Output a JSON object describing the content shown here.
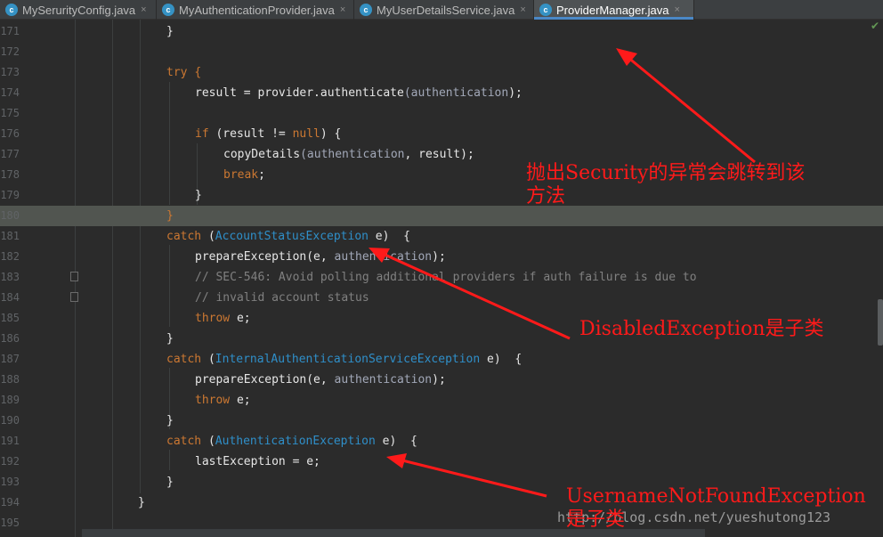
{
  "tabs": [
    {
      "label": "MySerurityConfig.java",
      "icon": "class-icon",
      "active": false
    },
    {
      "label": "MyAuthenticationProvider.java",
      "icon": "class-icon",
      "active": false
    },
    {
      "label": "MyUserDetailsService.java",
      "icon": "class-icon",
      "active": false
    },
    {
      "label": "ProviderManager.java",
      "icon": "class-icon",
      "active": true
    }
  ],
  "tab_close_glyph": "×",
  "tab_icon_letter": "c",
  "inspection_ok_glyph": "✔",
  "lines": [
    {
      "n": "171",
      "tokens": [
        [
          "",
          "}"
        ]
      ]
    },
    {
      "n": "172",
      "tokens": []
    },
    {
      "n": "173",
      "tokens": [
        [
          "kw",
          "try "
        ],
        [
          "kw",
          "{"
        ]
      ]
    },
    {
      "n": "174",
      "tokens": [
        [
          "",
          "result = provider."
        ],
        [
          "",
          "authenticate"
        ],
        [
          "prm",
          "(authentication"
        ],
        [
          "",
          ");"
        ]
      ]
    },
    {
      "n": "175",
      "tokens": []
    },
    {
      "n": "176",
      "tokens": [
        [
          "kw",
          "if "
        ],
        [
          "",
          "(result != "
        ],
        [
          "kw",
          "null"
        ],
        [
          "",
          ") {"
        ]
      ]
    },
    {
      "n": "177",
      "tokens": [
        [
          "",
          "copyDetails"
        ],
        [
          "prm",
          "(authentication"
        ],
        [
          "",
          ", result);"
        ]
      ]
    },
    {
      "n": "178",
      "tokens": [
        [
          "kw",
          "break"
        ],
        [
          "",
          ";"
        ]
      ]
    },
    {
      "n": "179",
      "tokens": [
        [
          "",
          "}"
        ]
      ]
    },
    {
      "n": "180",
      "tokens": [
        [
          "kw",
          "}"
        ]
      ]
    },
    {
      "n": "181",
      "tokens": [
        [
          "kw",
          "catch "
        ],
        [
          "",
          "("
        ],
        [
          "cls",
          "AccountStatusException"
        ],
        [
          "",
          " e)  {"
        ]
      ]
    },
    {
      "n": "182",
      "tokens": [
        [
          "",
          "prepareException(e, "
        ],
        [
          "prm",
          "authentication"
        ],
        [
          "",
          ");"
        ]
      ]
    },
    {
      "n": "183",
      "tokens": [
        [
          "cmt",
          "// SEC-546: Avoid polling additional providers if auth failure is due to"
        ]
      ]
    },
    {
      "n": "184",
      "tokens": [
        [
          "cmt",
          "// invalid account status"
        ]
      ]
    },
    {
      "n": "185",
      "tokens": [
        [
          "kw",
          "throw "
        ],
        [
          "",
          "e;"
        ]
      ]
    },
    {
      "n": "186",
      "tokens": [
        [
          "",
          "}"
        ]
      ]
    },
    {
      "n": "187",
      "tokens": [
        [
          "kw",
          "catch "
        ],
        [
          "",
          "("
        ],
        [
          "cls",
          "InternalAuthenticationServiceException"
        ],
        [
          "",
          " e)  {"
        ]
      ]
    },
    {
      "n": "188",
      "tokens": [
        [
          "",
          "prepareException(e, "
        ],
        [
          "prm",
          "authentication"
        ],
        [
          "",
          ");"
        ]
      ]
    },
    {
      "n": "189",
      "tokens": [
        [
          "kw",
          "throw "
        ],
        [
          "",
          "e;"
        ]
      ]
    },
    {
      "n": "190",
      "tokens": [
        [
          "",
          "}"
        ]
      ]
    },
    {
      "n": "191",
      "tokens": [
        [
          "kw",
          "catch "
        ],
        [
          "",
          "("
        ],
        [
          "cls",
          "AuthenticationException"
        ],
        [
          "",
          " e)  {"
        ]
      ]
    },
    {
      "n": "192",
      "tokens": [
        [
          "",
          "lastException = e;"
        ]
      ]
    },
    {
      "n": "193",
      "tokens": [
        [
          "",
          "}"
        ]
      ]
    },
    {
      "n": "194",
      "tokens": [
        [
          "",
          "}"
        ]
      ]
    },
    {
      "n": "195",
      "tokens": []
    }
  ],
  "annotations": {
    "security_note": "抛出Security的异常会跳转到该\n方法",
    "disabled_note": "DisabledException是子类",
    "usernotfound_note": "UsernameNotFoundException\n是子类"
  },
  "watermark": "http://blog.csdn.net/yueshutong123",
  "colors": {
    "background": "#2b2b2b",
    "keyword": "#cc7832",
    "class_ref": "#2f8fc9",
    "comment": "#808080",
    "annotation_red": "#ff1a1a",
    "tab_active_underline": "#4a88c7"
  }
}
